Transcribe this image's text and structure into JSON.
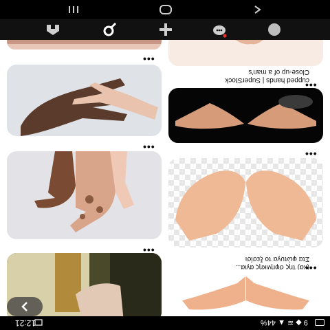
{
  "status": {
    "time": "12:21",
    "indicators": "9 ◆ ≋ ▲ 44%"
  },
  "tabs": [
    {
      "icon": "home-icon",
      "selected": false
    },
    {
      "icon": "search-icon",
      "selected": true
    },
    {
      "icon": "plus-icon",
      "selected": false
    },
    {
      "icon": "chat-icon",
      "selected": false,
      "badge": true
    },
    {
      "icon": "avatar-icon",
      "selected": false
    }
  ],
  "feed": {
    "left": [
      {
        "alt": "hand-closeup",
        "more": "•••"
      },
      {
        "alt": "hands-overlap-dark-light",
        "more": "•••"
      },
      {
        "alt": "hands-vitiligo",
        "more": "•••"
      },
      {
        "alt": "hand-holding-stick"
      }
    ],
    "right": [
      {
        "alt": "cupped-hands-top"
      },
      {
        "caption_lines": [
          "Close-up of a man's",
          "cupped hands | SuperStock"
        ],
        "more": "•••"
      },
      {
        "alt": "cupped-hands-dark",
        "more": "•••"
      },
      {
        "caption_lines": [
          "Στα φώτυγα το ξεσίσι",
          "(κα) της σφηνικής αγία..."
        ],
        "more": "•••"
      },
      {
        "alt": "cupped-hands-cutout"
      }
    ]
  },
  "back_label": "<",
  "colors": {
    "accent_badge": "#e0302b",
    "tabbar": "#111111",
    "feed_bg": "#ffffff"
  }
}
